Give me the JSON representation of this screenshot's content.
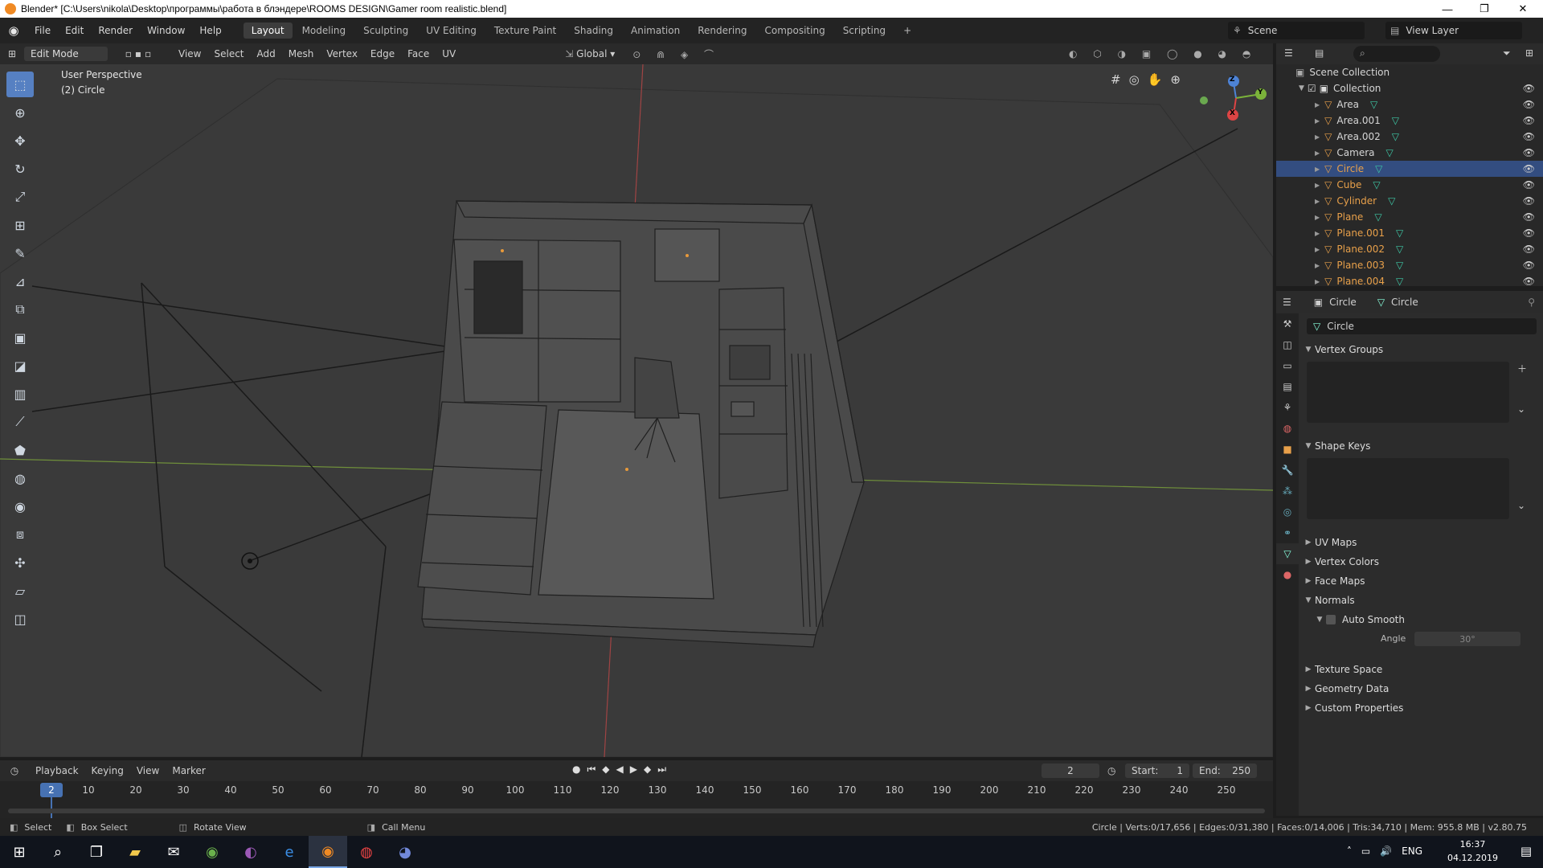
{
  "window": {
    "title": "Blender* [C:\\Users\\nikola\\Desktop\\программы\\работа в блэндере\\ROOMS DESIGN\\Gamer room realistic.blend]",
    "minimize": "—",
    "maximize": "❐",
    "close": "✕"
  },
  "menu": {
    "items": [
      "File",
      "Edit",
      "Render",
      "Window",
      "Help"
    ],
    "workspaces": [
      "Layout",
      "Modeling",
      "Sculpting",
      "UV Editing",
      "Texture Paint",
      "Shading",
      "Animation",
      "Rendering",
      "Compositing",
      "Scripting"
    ],
    "add_tab": "+",
    "scene_label": "Scene",
    "view_layer_label": "View Layer"
  },
  "viewport_header": {
    "mode": "Edit Mode",
    "menus": [
      "View",
      "Select",
      "Add",
      "Mesh",
      "Vertex",
      "Edge",
      "Face",
      "UV"
    ],
    "orientation": "Global"
  },
  "viewport": {
    "perspective": "User Perspective",
    "object": "(2) Circle",
    "gizmo": {
      "z": "Z",
      "y": "Y",
      "x": "X"
    }
  },
  "outliner": {
    "root": "Scene Collection",
    "collection": "Collection",
    "items": [
      {
        "name": "Area",
        "orange": false,
        "selected": false
      },
      {
        "name": "Area.001",
        "orange": false,
        "selected": false
      },
      {
        "name": "Area.002",
        "orange": false,
        "selected": false
      },
      {
        "name": "Camera",
        "orange": false,
        "selected": false
      },
      {
        "name": "Circle",
        "orange": true,
        "selected": true
      },
      {
        "name": "Cube",
        "orange": true,
        "selected": false
      },
      {
        "name": "Cylinder",
        "orange": true,
        "selected": false
      },
      {
        "name": "Plane",
        "orange": true,
        "selected": false
      },
      {
        "name": "Plane.001",
        "orange": true,
        "selected": false
      },
      {
        "name": "Plane.002",
        "orange": true,
        "selected": false
      },
      {
        "name": "Plane.003",
        "orange": true,
        "selected": false
      },
      {
        "name": "Plane.004",
        "orange": true,
        "selected": false
      }
    ]
  },
  "properties": {
    "breadcrumb_object": "Circle",
    "breadcrumb_data": "Circle",
    "data_name": "Circle",
    "vertex_groups": "Vertex Groups",
    "shape_keys": "Shape Keys",
    "uv_maps": "UV Maps",
    "vertex_colors": "Vertex Colors",
    "face_maps": "Face Maps",
    "normals": "Normals",
    "auto_smooth": "Auto Smooth",
    "angle_label": "Angle",
    "angle_value": "30°",
    "texture_space": "Texture Space",
    "geometry_data": "Geometry Data",
    "custom_properties": "Custom Properties"
  },
  "timeline": {
    "menus": [
      "Playback",
      "Keying",
      "View",
      "Marker"
    ],
    "current_frame": "2",
    "start_label": "Start:",
    "start_value": "1",
    "end_label": "End:",
    "end_value": "250",
    "playhead": "2",
    "ticks": [
      "10",
      "20",
      "30",
      "40",
      "50",
      "60",
      "70",
      "80",
      "90",
      "100",
      "110",
      "120",
      "130",
      "140",
      "150",
      "160",
      "170",
      "180",
      "190",
      "200",
      "210",
      "220",
      "230",
      "240",
      "250"
    ]
  },
  "status": {
    "select": "Select",
    "box_select": "Box Select",
    "rotate_view": "Rotate View",
    "call_menu": "Call Menu",
    "stats": "Circle | Verts:0/17,656 | Edges:0/31,380 | Faces:0/14,006 | Tris:34,710 | Mem: 955.8 MB | v2.80.75"
  },
  "taskbar": {
    "lang": "ENG",
    "time": "16:37",
    "date": "04.12.2019"
  },
  "colors": {
    "accent": "#5680c2",
    "selected_row": "#334d80",
    "orange": "#e8a04a"
  }
}
